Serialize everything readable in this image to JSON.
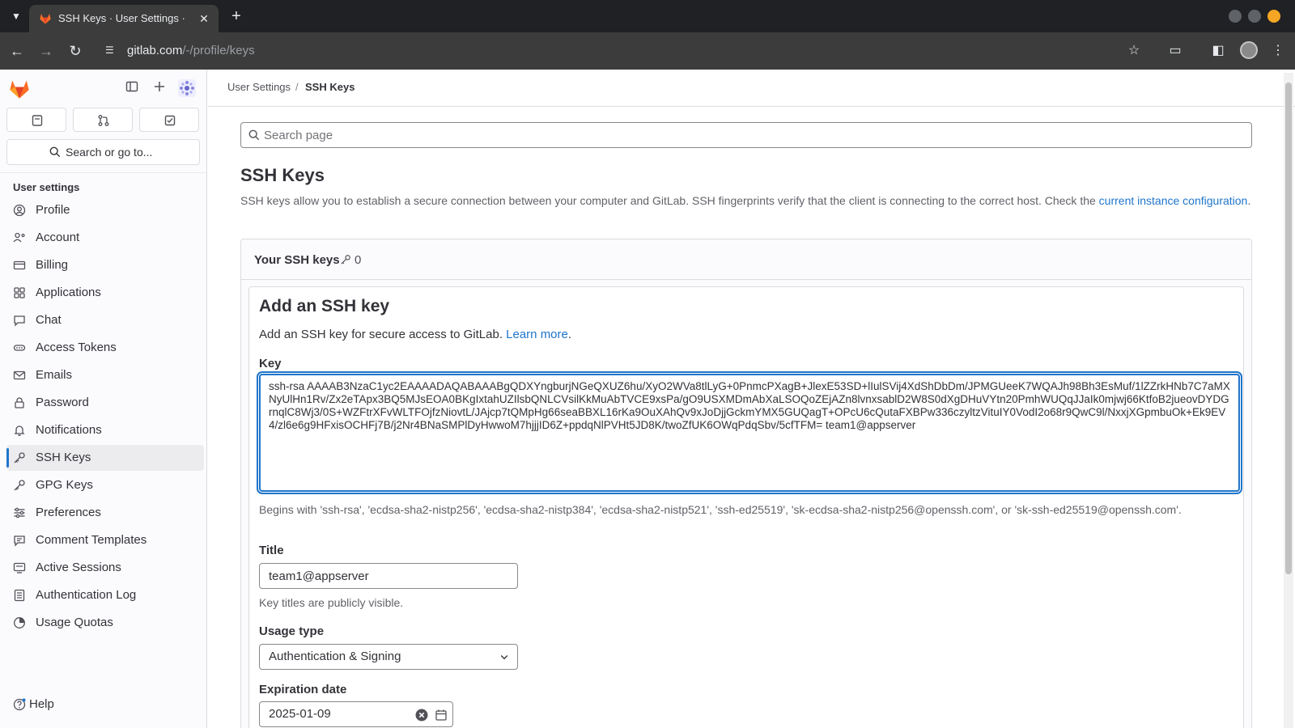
{
  "browser": {
    "tab_title": "SSH Keys · User Settings · GitLab",
    "url_host": "gitlab.com",
    "url_path": "/-/profile/keys"
  },
  "breadcrumb": {
    "parent": "User Settings",
    "separator": "/",
    "current": "SSH Keys"
  },
  "sidebar": {
    "search_label": "Search or go to...",
    "section_title": "User settings",
    "items": [
      {
        "label": "Profile",
        "icon": "profile-icon"
      },
      {
        "label": "Account",
        "icon": "account-icon"
      },
      {
        "label": "Billing",
        "icon": "billing-icon"
      },
      {
        "label": "Applications",
        "icon": "applications-icon"
      },
      {
        "label": "Chat",
        "icon": "chat-icon"
      },
      {
        "label": "Access Tokens",
        "icon": "token-icon"
      },
      {
        "label": "Emails",
        "icon": "mail-icon"
      },
      {
        "label": "Password",
        "icon": "lock-icon"
      },
      {
        "label": "Notifications",
        "icon": "bell-icon"
      },
      {
        "label": "SSH Keys",
        "icon": "key-icon",
        "active": true
      },
      {
        "label": "GPG Keys",
        "icon": "key-icon"
      },
      {
        "label": "Preferences",
        "icon": "preferences-icon"
      },
      {
        "label": "Comment Templates",
        "icon": "comment-icon"
      },
      {
        "label": "Active Sessions",
        "icon": "sessions-icon"
      },
      {
        "label": "Authentication Log",
        "icon": "log-icon"
      },
      {
        "label": "Usage Quotas",
        "icon": "quota-icon"
      }
    ],
    "help_label": "Help"
  },
  "main": {
    "search_placeholder": "Search page",
    "title": "SSH Keys",
    "description": "SSH keys allow you to establish a secure connection between your computer and GitLab. SSH fingerprints verify that the client is connecting to the correct host. Check the ",
    "description_link": "current instance configuration",
    "description_end": ".",
    "your_keys_label": "Your SSH keys",
    "your_keys_count": "0",
    "add_title": "Add an SSH key",
    "add_desc": "Add an SSH key for secure access to GitLab. ",
    "add_desc_link": "Learn more",
    "add_desc_end": ".",
    "key_label": "Key",
    "key_value": "ssh-rsa AAAAB3NzaC1yc2EAAAADAQABAAABgQDXYngburjNGeQXUZ6hu/XyO2WVa8tlLyG+0PnmcPXagB+JlexE53SD+lIulSVij4XdShDbDm/JPMGUeeK7WQAJh98Bh3EsMuf/1lZZrkHNb7C7aMXNyUlHn1Rv/Zx2eTApx3BQ5MJsEOA0BKgIxtahUZIlsbQNLCVsilKkMuAbTVCE9xsPa/gO9USXMDmAbXaLSOQoZEjAZn8lvnxsablD2W8S0dXgDHuVYtn20PmhWUQqJJaIk0mjwj66KtfoB2jueovDYDGrnqlC8Wj3/0S+WZFtrXFvWLTFOjfzNiovtL/JAjcp7tQMpHg66seaBBXL16rKa9OuXAhQv9xJoDjjGckmYMX5GUQagT+OPcU6cQutaFXBPw336czyltzVituIY0VodI2o68r9QwC9l/NxxjXGpmbuOk+Ek9EV4/zl6e6g9HFxisOCHFj7B/j2Nr4BNaSMPlDyHwwoM7hjjjID6Z+ppdqNlPVHt5JD8K/twoZfUK6OWqPdqSbv/5cfTFM= team1@appserver",
    "key_help": "Begins with 'ssh-rsa', 'ecdsa-sha2-nistp256', 'ecdsa-sha2-nistp384', 'ecdsa-sha2-nistp521', 'ssh-ed25519', 'sk-ecdsa-sha2-nistp256@openssh.com', or 'sk-ssh-ed25519@openssh.com'.",
    "title_label": "Title",
    "title_value": "team1@appserver",
    "title_help": "Key titles are publicly visible.",
    "usage_label": "Usage type",
    "usage_value": "Authentication & Signing",
    "expiration_label": "Expiration date",
    "expiration_value": "2025-01-09"
  },
  "colors": {
    "link": "#1f75cb",
    "sidebar_bg": "#fbfafd",
    "active_bar": "#1f75cb",
    "gitlab_orange": "#e24329"
  }
}
